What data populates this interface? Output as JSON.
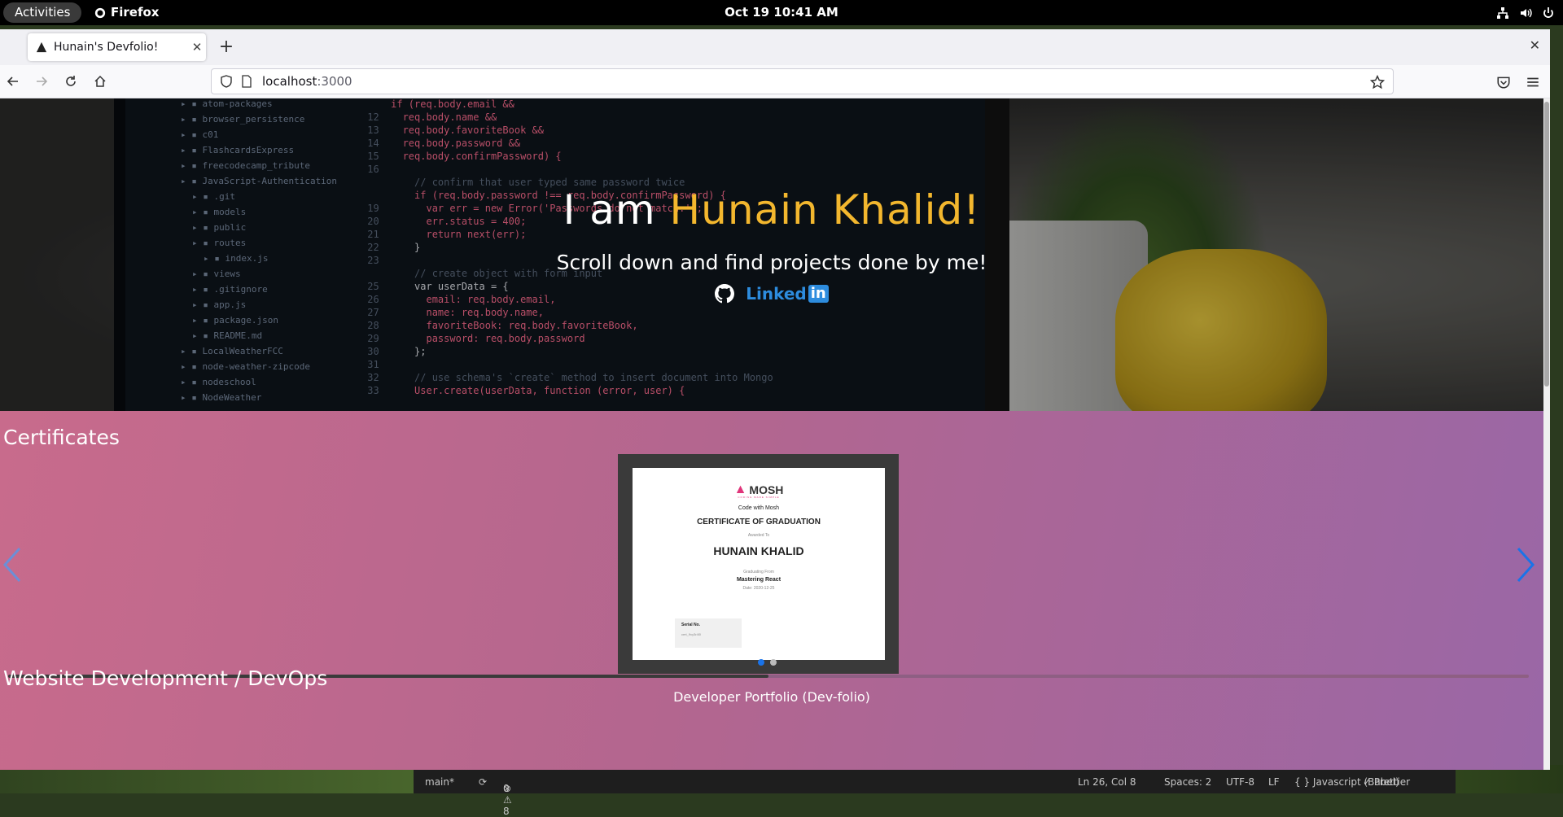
{
  "topbar": {
    "activities": "Activities",
    "app_name": "Firefox",
    "clock": "Oct 19  10:41 AM"
  },
  "browser": {
    "tab_title": "Hunain's Devfolio!",
    "url_host": "localhost",
    "url_port": ":3000"
  },
  "hero": {
    "title_prefix": "I am ",
    "title_name": "Hunain Khalid!",
    "subtitle": "Scroll down and find projects done by me!",
    "linkedin_text": "Linked",
    "linkedin_box": "in"
  },
  "background_code": {
    "tree": [
      "atom-packages",
      "browser_persistence",
      "c01",
      "FlashcardsExpress",
      "freecodecamp_tribute",
      "JavaScript-Authentication",
      ".git",
      "models",
      "public",
      "routes",
      "index.js",
      "views",
      ".gitignore",
      "app.js",
      "package.json",
      "README.md",
      "LocalWeatherFCC",
      "node-weather-zipcode",
      "nodeschool",
      "NodeWeather"
    ],
    "lines": [
      "if (req.body.email &&",
      "  req.body.name &&",
      "  req.body.favoriteBook &&",
      "  req.body.password &&",
      "  req.body.confirmPassword) {",
      "",
      "    // confirm that user typed same password twice",
      "    if (req.body.password !== req.body.confirmPassword) {",
      "      var err = new Error('Passwords do not match.');",
      "      err.status = 400;",
      "      return next(err);",
      "    }",
      "",
      "    // create object with form input",
      "    var userData = {",
      "      email: req.body.email,",
      "      name: req.body.name,",
      "      favoriteBook: req.body.favoriteBook,",
      "      password: req.body.password",
      "    };",
      "",
      "    // use schema's `create` method to insert document into Mongo",
      "    User.create(userData, function (error, user) {"
    ],
    "line_numbers": [
      "",
      "12",
      "13",
      "14",
      "15",
      "16",
      "",
      "",
      "19",
      "20",
      "21",
      "22",
      "23",
      "",
      "25",
      "26",
      "27",
      "28",
      "29",
      "30",
      "31",
      "32",
      "33"
    ]
  },
  "certificates": {
    "heading": "Certificates",
    "logo": "MOSH",
    "tagline": "CODING MADE SIMPLE",
    "school": "Code with Mosh",
    "type": "CERTIFICATE OF GRADUATION",
    "awarded": "Awarded To",
    "name": "HUNAIN KHALID",
    "graduating": "Graduating From",
    "course": "Mastering React",
    "date": "Date: 2020-12-25",
    "serial_label": "Serial No.",
    "serial_value": "cert_9vy3r4l0",
    "slide_count": 2,
    "active_slide": 0,
    "progress_fraction": 0.5
  },
  "web_dev": {
    "heading": "Website Development / DevOps",
    "project_title": "Developer Portfolio (Dev-folio)"
  },
  "vscode_status": {
    "branch": "main*",
    "problems": "0 ⚠ 8",
    "errors_icon": "⊗",
    "position": "Ln 26, Col 8",
    "spaces": "Spaces: 2",
    "encoding": "UTF-8",
    "eol": "LF",
    "language": "{ } Javascript (Babel)",
    "formatter": "✓ Prettier"
  },
  "colors": {
    "accent_name": "#f3b72e",
    "linkedin": "#2d8cde",
    "carousel_arrow": "#1a73e8"
  },
  "icons": [
    "firefox-icon",
    "network-icon",
    "volume-icon",
    "power-icon",
    "back-icon",
    "forward-icon",
    "reload-icon",
    "home-icon",
    "shield-icon",
    "page-icon",
    "star-icon",
    "pocket-icon",
    "menu-icon",
    "github-icon",
    "linkedin-icon",
    "chevron-left-icon",
    "chevron-right-icon"
  ]
}
